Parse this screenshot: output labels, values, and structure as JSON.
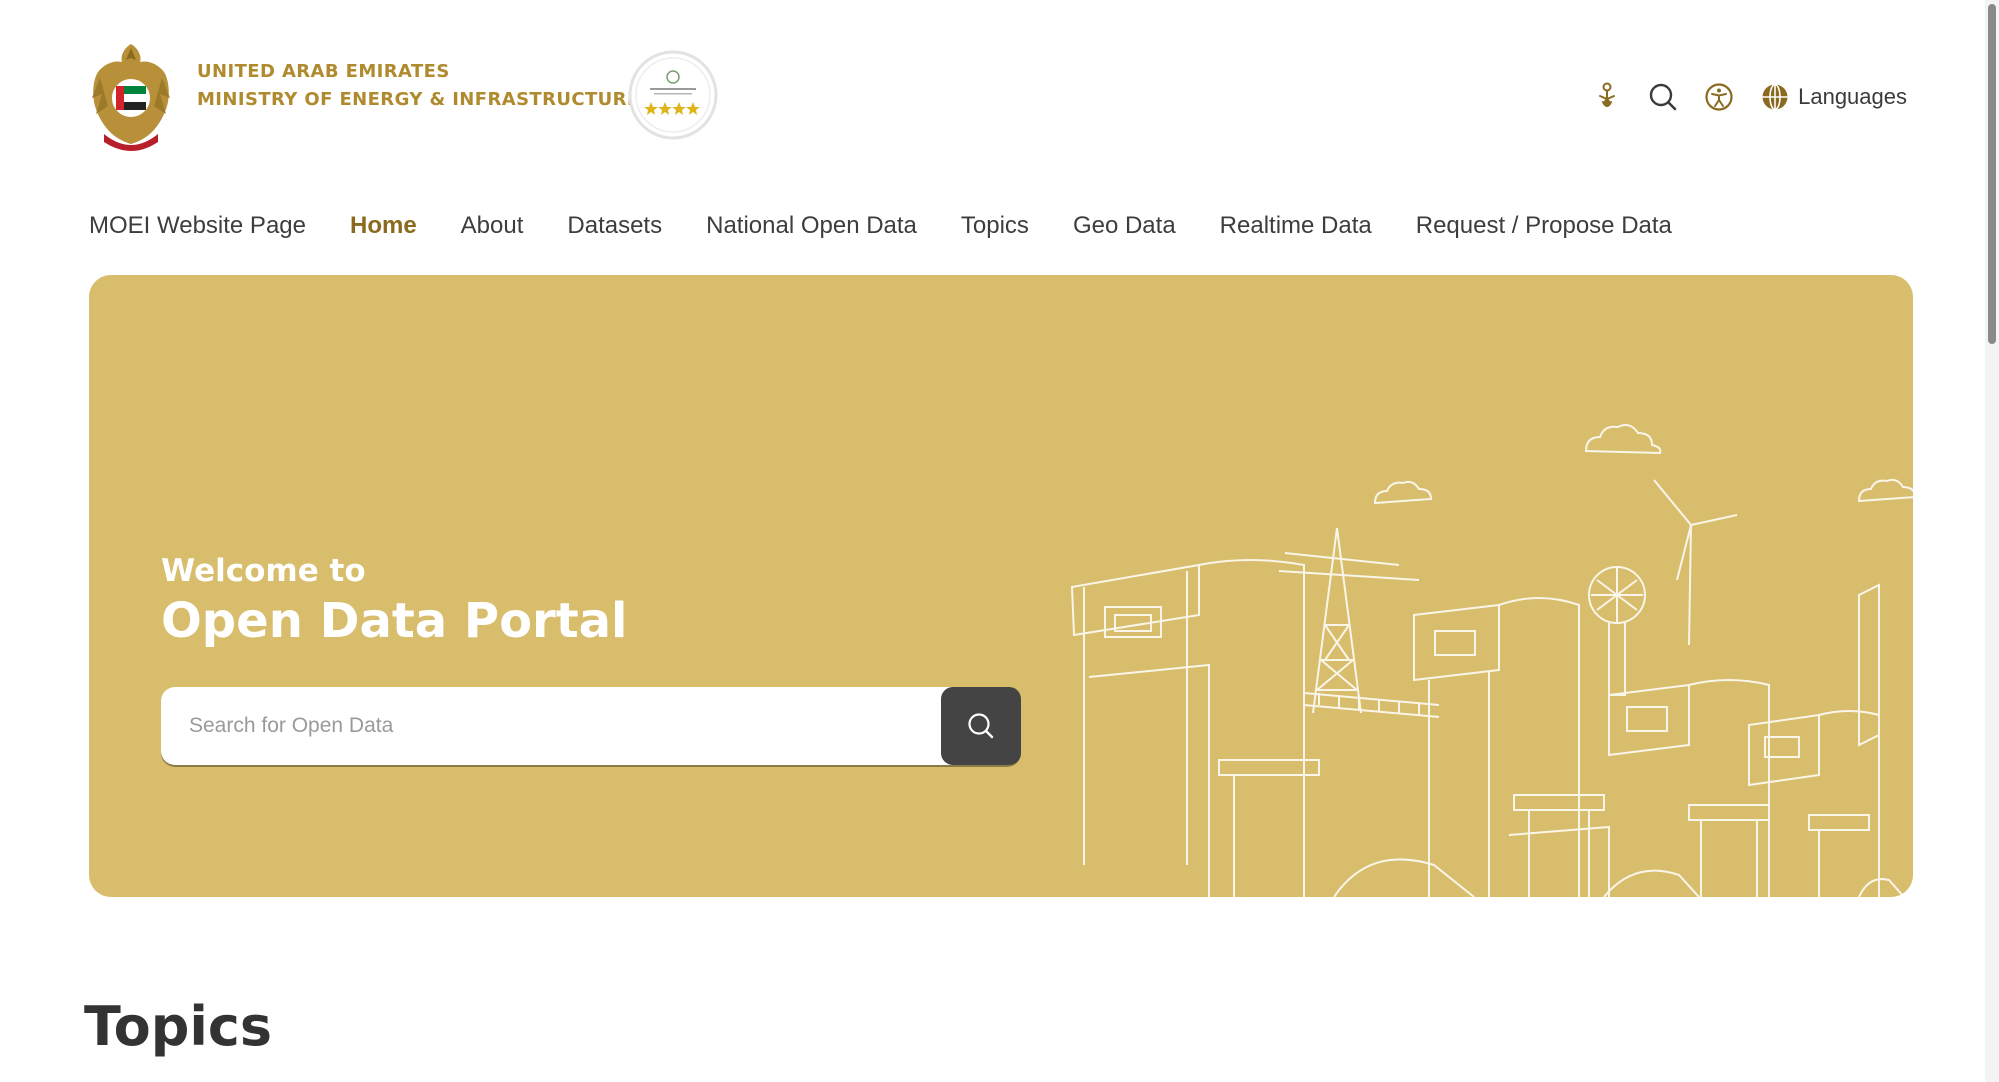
{
  "header": {
    "org_line_1": "UNITED ARAB EMIRATES",
    "org_line_2": "MINISTRY OF ENERGY & INFRASTRUCTURE",
    "emblem_icon": "uae-emblem-icon",
    "badge_icon": "four-star-rating-badge-icon",
    "utility": {
      "icons": [
        "sign-language-icon",
        "search-icon",
        "accessibility-icon",
        "globe-icon"
      ],
      "languages_label": "Languages"
    }
  },
  "nav": {
    "items": [
      {
        "label": "MOEI Website Page"
      },
      {
        "label": "Home",
        "active": true
      },
      {
        "label": "About"
      },
      {
        "label": "Datasets"
      },
      {
        "label": "National Open Data"
      },
      {
        "label": "Topics"
      },
      {
        "label": "Geo Data"
      },
      {
        "label": "Realtime Data"
      },
      {
        "label": "Request / Propose Data"
      }
    ]
  },
  "hero": {
    "pre_title": "Welcome to",
    "title": "Open Data Portal",
    "search": {
      "placeholder": "Search for Open Data",
      "value": "",
      "button_icon": "search-icon"
    }
  },
  "topics": {
    "title": "Topics"
  },
  "colors": {
    "brand_gold": "#b08a2e",
    "active_nav": "#8a6a1f",
    "hero_bg": "#d8bd6d",
    "search_button": "#444444",
    "text_dark": "#3d3d3d"
  }
}
